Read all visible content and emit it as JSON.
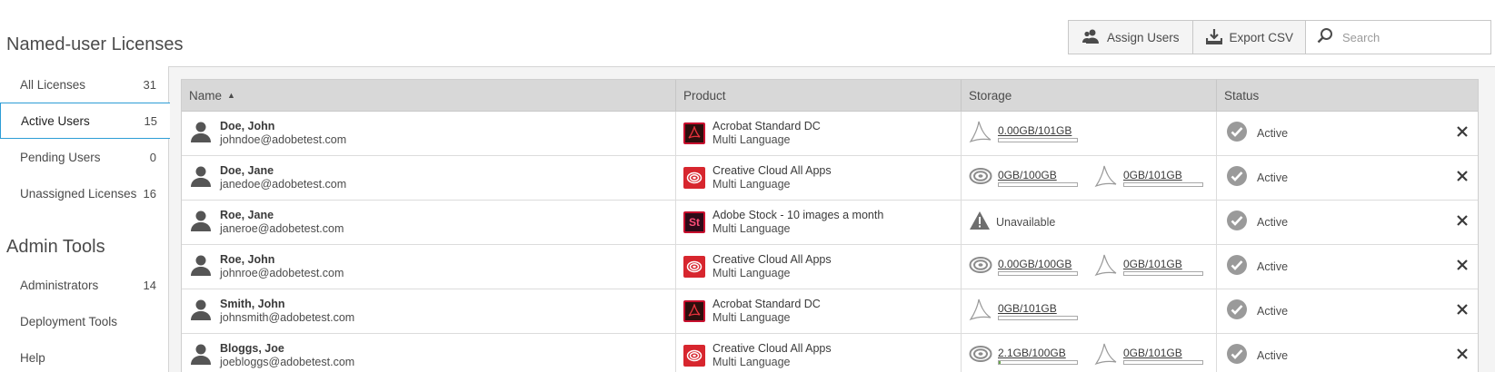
{
  "page_title": "Named-user Licenses",
  "sidebar": {
    "items": [
      {
        "label": "All Licenses",
        "count": "31"
      },
      {
        "label": "Active Users",
        "count": "15"
      },
      {
        "label": "Pending Users",
        "count": "0"
      },
      {
        "label": "Unassigned Licenses",
        "count": "16"
      }
    ],
    "active_index": 1
  },
  "admin_tools": {
    "title": "Admin Tools",
    "items": [
      {
        "label": "Administrators",
        "count": "14"
      },
      {
        "label": "Deployment Tools",
        "count": ""
      },
      {
        "label": "Help",
        "count": ""
      }
    ]
  },
  "toolbar": {
    "assign_label": "Assign Users",
    "export_label": "Export CSV",
    "search_placeholder": "Search"
  },
  "table": {
    "columns": [
      "Name",
      "Product",
      "Storage",
      "Status"
    ],
    "sort_column": "Name",
    "rows": [
      {
        "name": "Doe, John",
        "email": "johndoe@adobetest.com",
        "product": "Acrobat Standard DC",
        "language": "Multi Language",
        "product_icon": "acrobat",
        "storage": [
          {
            "icon": "acrobat-storage-icon",
            "value": "0.00GB/101GB",
            "fraction": 0
          }
        ],
        "status": "Active"
      },
      {
        "name": "Doe, Jane",
        "email": "janedoe@adobetest.com",
        "product": "Creative Cloud All Apps",
        "language": "Multi Language",
        "product_icon": "cc",
        "storage": [
          {
            "icon": "cloud-storage-icon",
            "value": "0GB/100GB",
            "fraction": 0
          },
          {
            "icon": "acrobat-storage-icon",
            "value": "0GB/101GB",
            "fraction": 0
          }
        ],
        "status": "Active"
      },
      {
        "name": "Roe, Jane",
        "email": "janeroe@adobetest.com",
        "product": "Adobe Stock - 10 images a month",
        "language": "Multi Language",
        "product_icon": "stock",
        "storage_unavailable": "Unavailable",
        "status": "Active"
      },
      {
        "name": "Roe, John",
        "email": "johnroe@adobetest.com",
        "product": "Creative Cloud All Apps",
        "language": "Multi Language",
        "product_icon": "cc",
        "storage": [
          {
            "icon": "cloud-storage-icon",
            "value": "0.00GB/100GB",
            "fraction": 0
          },
          {
            "icon": "acrobat-storage-icon",
            "value": "0GB/101GB",
            "fraction": 0
          }
        ],
        "status": "Active"
      },
      {
        "name": "Smith, John",
        "email": "johnsmith@adobetest.com",
        "product": "Acrobat Standard DC",
        "language": "Multi Language",
        "product_icon": "acrobat",
        "storage": [
          {
            "icon": "acrobat-storage-icon",
            "value": "0GB/101GB",
            "fraction": 0
          }
        ],
        "status": "Active"
      },
      {
        "name": "Bloggs, Joe",
        "email": "joebloggs@adobetest.com",
        "product": "Creative Cloud All Apps",
        "language": "Multi Language",
        "product_icon": "cc",
        "storage": [
          {
            "icon": "cloud-storage-icon",
            "value": "2.1GB/100GB",
            "fraction": 0.021
          },
          {
            "icon": "acrobat-storage-icon",
            "value": "0GB/101GB",
            "fraction": 0
          }
        ],
        "status": "Active"
      }
    ]
  },
  "stock_icon_text": "St",
  "colors": {
    "accent": "#2d9dd6",
    "adobe_red": "#d7262e"
  }
}
